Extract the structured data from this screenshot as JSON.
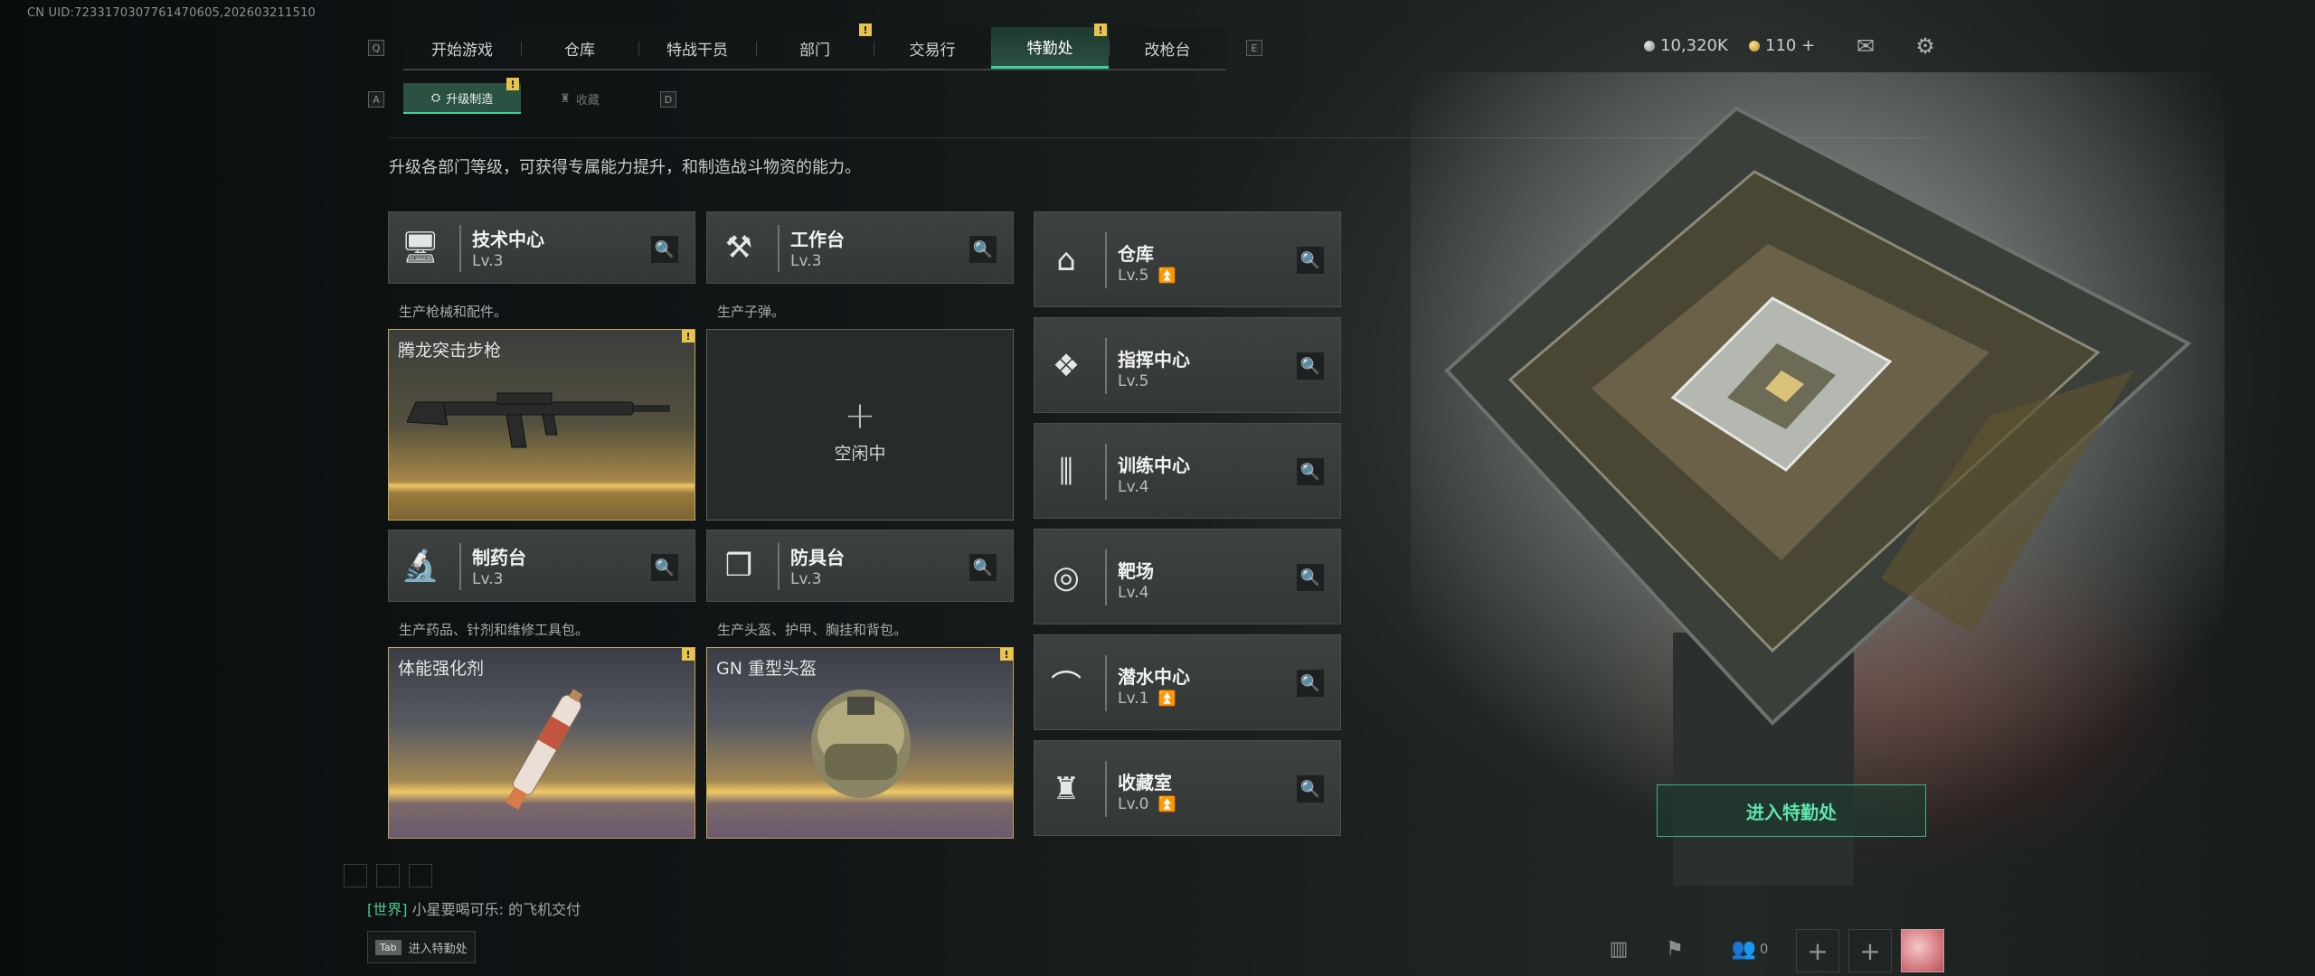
{
  "uid": "CN UID:7233170307761470605,202603211510",
  "nav": {
    "left_key": "Q",
    "right_key": "E",
    "tabs": [
      {
        "label": "开始游戏",
        "badge": ""
      },
      {
        "label": "仓库",
        "badge": ""
      },
      {
        "label": "特战干员",
        "badge": ""
      },
      {
        "label": "部门",
        "badge": "!"
      },
      {
        "label": "交易行",
        "badge": ""
      },
      {
        "label": "特勤处",
        "badge": "!",
        "active": true
      },
      {
        "label": "改枪台",
        "badge": ""
      }
    ]
  },
  "subnav": {
    "left_key": "A",
    "right_key": "D",
    "tabs": [
      {
        "label": "升级制造",
        "badge": "!",
        "active": true
      },
      {
        "label": "收藏",
        "badge": ""
      }
    ]
  },
  "currency": {
    "silver": "10,320K",
    "gold": "110 +"
  },
  "description": "升级各部门等级，可获得专属能力提升，和制造战斗物资的能力。",
  "departments_left": [
    {
      "name": "技术中心",
      "level": "Lv.3",
      "icon": "computer-icon",
      "desc": "生产枪械和配件。",
      "slot": {
        "title": "腾龙突击步枪",
        "state": "producing",
        "badge": "!",
        "item_icon": "rifle-icon"
      }
    },
    {
      "name": "工作台",
      "level": "Lv.3",
      "icon": "tools-icon",
      "desc": "生产子弹。",
      "slot": {
        "title": "",
        "state": "idle",
        "idle_text": "空闲中",
        "plus": "+"
      }
    },
    {
      "name": "制药台",
      "level": "Lv.3",
      "icon": "microscope-icon",
      "desc": "生产药品、针剂和维修工具包。",
      "slot": {
        "title": "体能强化剂",
        "state": "producing",
        "badge": "!",
        "item_icon": "injector-icon"
      }
    },
    {
      "name": "防具台",
      "level": "Lv.3",
      "icon": "cubes-icon",
      "desc": "生产头盔、护甲、胸挂和背包。",
      "slot": {
        "title": "GN 重型头盔",
        "state": "producing",
        "badge": "!",
        "item_icon": "helmet-icon"
      }
    }
  ],
  "departments_right": [
    {
      "name": "仓库",
      "level": "Lv.5",
      "icon": "warehouse-icon",
      "upgrade": true
    },
    {
      "name": "指挥中心",
      "level": "Lv.5",
      "icon": "command-icon",
      "upgrade": false
    },
    {
      "name": "训练中心",
      "level": "Lv.4",
      "icon": "dumbbell-icon",
      "upgrade": false
    },
    {
      "name": "靶场",
      "level": "Lv.4",
      "icon": "target-icon",
      "upgrade": false
    },
    {
      "name": "潜水中心",
      "level": "Lv.1",
      "icon": "diving-mask-icon",
      "upgrade": true
    },
    {
      "name": "收藏室",
      "level": "Lv.0",
      "icon": "trophy-icon",
      "upgrade": true
    }
  ],
  "enter_button": "进入特勤处",
  "chat": {
    "channel": "[世界]",
    "message": "小星要喝可乐: 的飞机交付"
  },
  "tab_hint": {
    "key": "Tab",
    "label": "进入特勤处"
  },
  "bottom": {
    "friends_count": "0"
  },
  "colors": {
    "accent_green": "#3fd29a",
    "badge_yellow": "#e8c44a",
    "gold_bar": "#f0c865"
  }
}
